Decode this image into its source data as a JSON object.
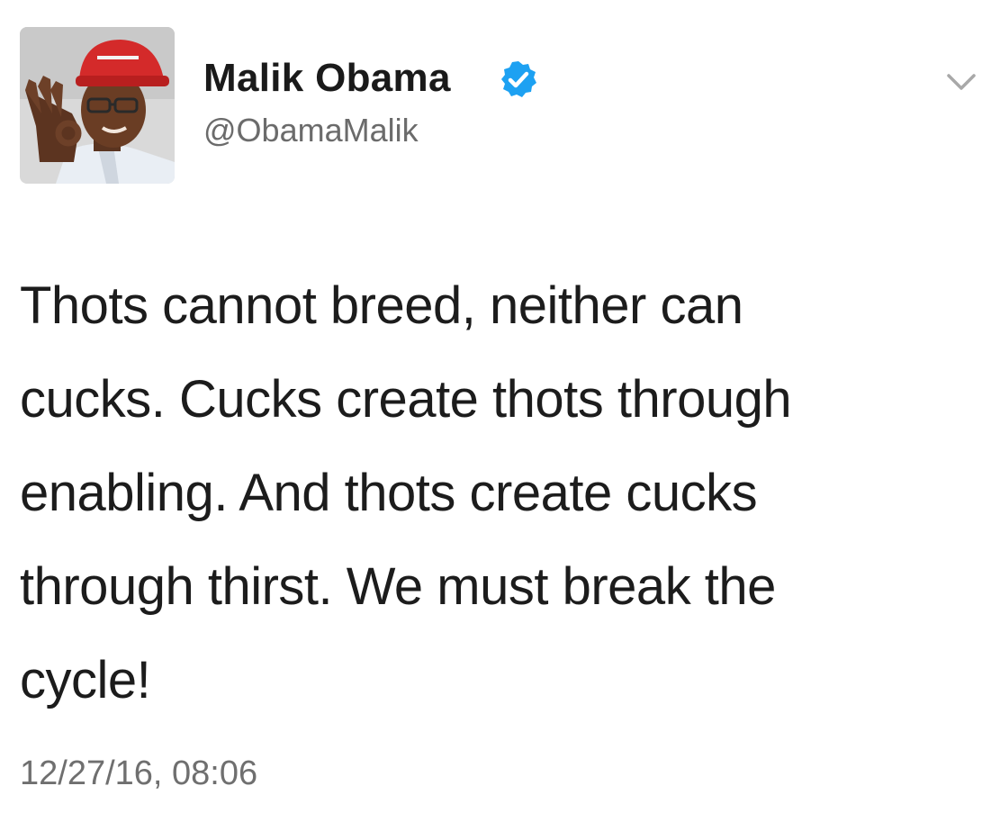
{
  "author": {
    "display_name": "Malik Obama",
    "handle": "@ObamaMalik",
    "verified": true,
    "avatar_icon": "avatar-photo-red-cap"
  },
  "tweet": {
    "text_lines": [
      "Thots cannot breed, neither can",
      "cucks. Cucks create thots through",
      "enabling. And thots create cucks",
      "through thirst. We must break the",
      "cycle!"
    ],
    "timestamp": "12/27/16, 08:06"
  },
  "icons": {
    "verified": "verified-badge-icon",
    "menu": "chevron-down-icon"
  },
  "colors": {
    "verified_blue": "#1da1f2",
    "text": "#1c1c1c",
    "secondary_text": "#6b6b6b",
    "cap_red": "#d42a2a"
  }
}
